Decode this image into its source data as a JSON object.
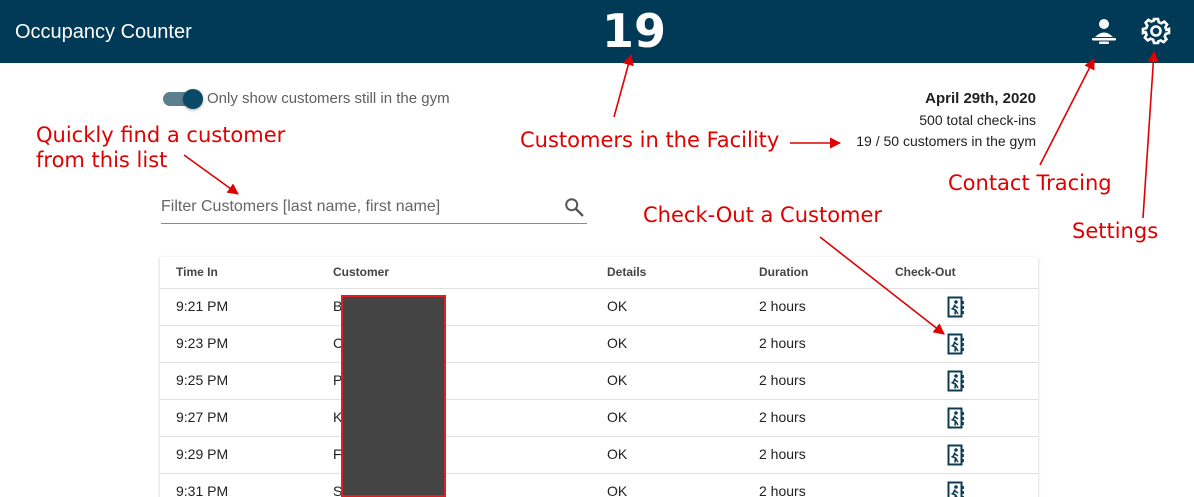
{
  "appbar": {
    "title": "Occupancy Counter",
    "occupancy_count": "19",
    "icons": [
      "contact-tracing-icon",
      "settings-icon"
    ]
  },
  "filters": {
    "toggle_label": "Only show customers still in the gym",
    "toggle_on": true,
    "search_placeholder": "Filter Customers [last name, first name]"
  },
  "summary": {
    "date": "April 29th, 2020",
    "total_checkins": "500 total check-ins",
    "in_gym": "19 / 50 customers in the gym"
  },
  "table": {
    "headers": [
      "Time In",
      "Customer",
      "Details",
      "Duration",
      "Check-Out"
    ],
    "rows": [
      {
        "time": "9:21 PM",
        "customer": "B",
        "details": "OK",
        "duration": "2 hours"
      },
      {
        "time": "9:23 PM",
        "customer": "C",
        "details": "OK",
        "duration": "2 hours"
      },
      {
        "time": "9:25 PM",
        "customer": "P",
        "details": "OK",
        "duration": "2 hours"
      },
      {
        "time": "9:27 PM",
        "customer": "K",
        "details": "OK",
        "duration": "2 hours"
      },
      {
        "time": "9:29 PM",
        "customer": "F",
        "details": "OK",
        "duration": "2 hours"
      },
      {
        "time": "9:31 PM",
        "customer": "S                    es",
        "details": "OK",
        "duration": "2 hours"
      }
    ]
  },
  "annotations": {
    "quick_find": "Quickly find a customer\nfrom this list",
    "customers_in_facility": "Customers in the Facility",
    "contact_tracing": "Contact Tracing",
    "settings": "Settings",
    "checkout": "Check-Out a Customer"
  },
  "colors": {
    "appbar": "#003a57",
    "annotation": "#e00000",
    "toggle_thumb": "#0b4a66"
  }
}
